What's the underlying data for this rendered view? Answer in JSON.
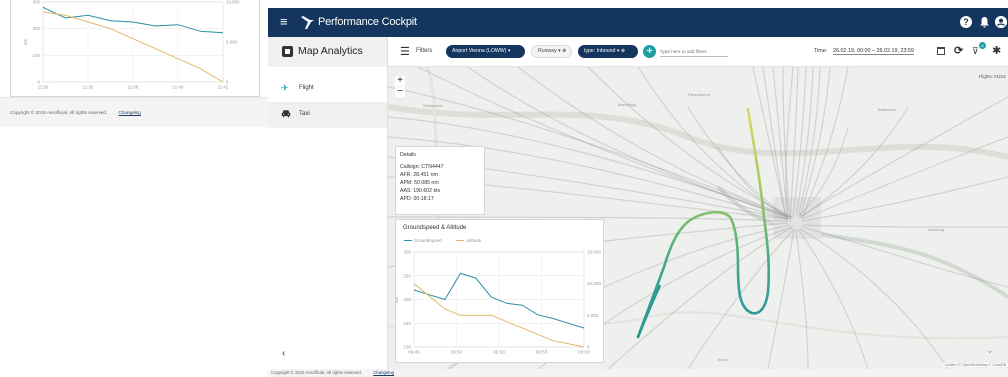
{
  "left_window": {
    "chart": {
      "x_ticks": [
        "11:30",
        "11:35",
        "11:38",
        "11:40",
        "11:42"
      ],
      "y_left_ticks": [
        "300",
        "200",
        "100",
        "0"
      ],
      "y_right_ticks": [
        "10,000",
        "5,000",
        "0"
      ],
      "y_left_label": "kts",
      "series_colors": {
        "groundspeed": "#2a8fa3",
        "altitude": "#e2b969"
      }
    },
    "footer_copyright": "Copyright © 2015 Aerofficial. All rights reserved.",
    "footer_link": "Changelog"
  },
  "topbar": {
    "hamburger": "≡",
    "title": "Performance Cockpit",
    "help_icon": "?",
    "bell_icon": "🔔",
    "user_icon": "👤"
  },
  "subbar": {
    "section_title": "Map Analytics",
    "filters_label": "Filters",
    "chips": {
      "airport": "Airport Vienna (LOWW) ▾",
      "runway": "Runway ▾ ⊗",
      "type": "type: Inbound ▾ ⊗"
    },
    "add_filter": "+",
    "search_placeholder": "Type here to add filters",
    "time_label": "Time:",
    "time_value": "26.02.19, 00:00 – 26.02.19, 23:59",
    "refresh_icon": "⟳",
    "funnel_icon": "⊽",
    "funnel_badge": "8",
    "settings_icon": "✱"
  },
  "sidebar": {
    "items": [
      {
        "label": "Flight",
        "icon": "✈"
      },
      {
        "label": "Taxi",
        "icon": "🚗"
      }
    ],
    "collapse": "‹"
  },
  "map": {
    "zoom_in": "+",
    "zoom_out": "−",
    "flights_count": "Flights: #1152",
    "attribution": "Leaflet | © OpenStreetMap © CartoDB",
    "scroll_down": "⌄",
    "place_labels": [
      "Bratislava",
      "Schwechat",
      "Bruck",
      "Marchegg",
      "Fischamend",
      "Hainburg"
    ]
  },
  "details": {
    "title": "Details",
    "rows": [
      "Callsign: CTN4447",
      "AFR: 28.451 nm",
      "APM: 50.085 nm",
      "AAS: 190.602 kts",
      "APD: 00:18:17"
    ]
  },
  "groundspeed_chart": {
    "title": "Groundspeed & Altitude",
    "legend": [
      "Groundspeed",
      "Altitude"
    ],
    "colors": {
      "groundspeed": "#2a8fa3",
      "altitude": "#e2b969"
    },
    "x_ticks": [
      "09:45",
      "09:50",
      "09:53",
      "09:55",
      "09:58"
    ],
    "y_left_ticks": [
      "300",
      "250",
      "200",
      "150",
      "100"
    ],
    "y_right_ticks": [
      "15,000",
      "10,000",
      "5,000",
      "0"
    ],
    "y_left_label": "kts",
    "y_right_label": "ft"
  },
  "footer": {
    "copyright": "Copyright © 2015 Aerofficial. All rights reserved.",
    "link": "Changelog"
  },
  "chart_data": [
    {
      "type": "line",
      "title": "Groundspeed & Altitude",
      "xlabel": "",
      "ylabel": "kts",
      "y2label": "ft",
      "x": [
        "09:45",
        "09:47",
        "09:49",
        "09:50",
        "09:51",
        "09:52",
        "09:53",
        "09:54",
        "09:55",
        "09:56",
        "09:57",
        "09:58"
      ],
      "series": [
        {
          "name": "Groundspeed",
          "axis": "left",
          "values": [
            220,
            210,
            200,
            255,
            245,
            205,
            192,
            188,
            168,
            160,
            150,
            140
          ]
        },
        {
          "name": "Altitude",
          "axis": "right",
          "values": [
            10000,
            8000,
            6000,
            5000,
            5000,
            5000,
            4000,
            3000,
            2000,
            1000,
            500,
            0
          ]
        }
      ],
      "ylim": [
        100,
        300
      ],
      "y2lim": [
        0,
        15000
      ],
      "grid": true,
      "legend_position": "top-left"
    },
    {
      "type": "line",
      "title": "",
      "xlabel": "",
      "ylabel": "kts",
      "x": [
        "11:30",
        "11:33",
        "11:35",
        "11:37",
        "11:38",
        "11:39",
        "11:40",
        "11:41",
        "11:42"
      ],
      "series": [
        {
          "name": "Groundspeed",
          "axis": "left",
          "values": [
            280,
            240,
            250,
            230,
            225,
            210,
            215,
            190,
            185
          ]
        },
        {
          "name": "Altitude",
          "axis": "right",
          "values": [
            10500,
            10000,
            9000,
            8000,
            6500,
            5000,
            3500,
            2000,
            0
          ]
        }
      ],
      "ylim": [
        0,
        300
      ],
      "y2lim": [
        0,
        12000
      ],
      "grid": true
    }
  ]
}
